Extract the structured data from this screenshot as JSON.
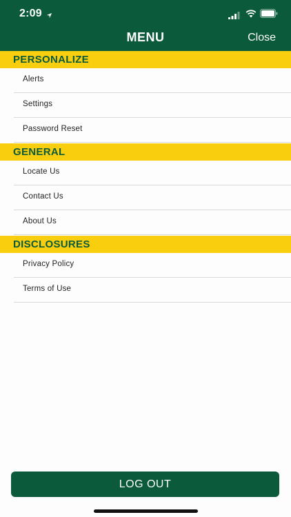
{
  "status_bar": {
    "time": "2:09"
  },
  "header": {
    "title": "MENU",
    "close_label": "Close"
  },
  "sections": [
    {
      "title": "PERSONALIZE",
      "items": [
        "Alerts",
        "Settings",
        "Password Reset"
      ]
    },
    {
      "title": "GENERAL",
      "items": [
        "Locate Us",
        "Contact Us",
        "About Us"
      ]
    },
    {
      "title": "DISCLOSURES",
      "items": [
        "Privacy Policy",
        "Terms of Use"
      ]
    }
  ],
  "footer": {
    "logout_label": "LOG OUT"
  },
  "colors": {
    "brand_green": "#0b5a3c",
    "accent_yellow": "#f8ce0e"
  },
  "icons": [
    "location-arrow-icon",
    "cellular-signal-icon",
    "wifi-icon",
    "battery-icon"
  ]
}
